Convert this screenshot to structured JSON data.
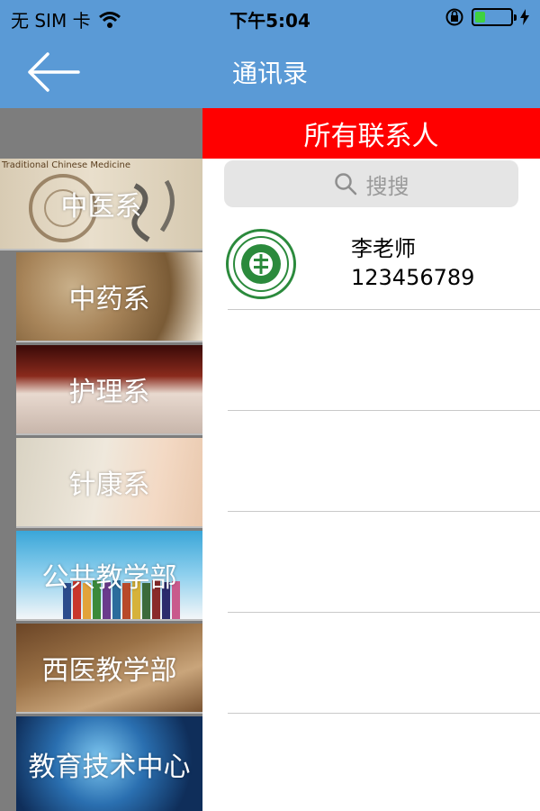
{
  "status_bar": {
    "carrier": "无 SIM 卡",
    "time": "下午5:04",
    "battery_level": 0.3,
    "wifi_icon": "wifi-icon",
    "lock_icon": "rotation-lock-icon",
    "charging_icon": "charging-bolt-icon"
  },
  "nav": {
    "title": "通讯录",
    "back_icon": "back-arrow-icon"
  },
  "sidebar": {
    "items": [
      {
        "label": "中医系",
        "banner_text": "Traditional Chinese Medicine"
      },
      {
        "label": "中药系"
      },
      {
        "label": "护理系"
      },
      {
        "label": "针康系"
      },
      {
        "label": "公共教学部"
      },
      {
        "label": "西医教学部"
      },
      {
        "label": "教育技术中心"
      }
    ]
  },
  "contacts": {
    "header": "所有联系人",
    "search_placeholder": "搜搜",
    "list": [
      {
        "name": "李老师",
        "phone": "123456789"
      }
    ]
  },
  "colors": {
    "nav_blue": "#5a9ad6",
    "header_red": "#ff0000",
    "sidebar_gray": "#7d7d7d",
    "logo_green": "#2b8a3c"
  }
}
